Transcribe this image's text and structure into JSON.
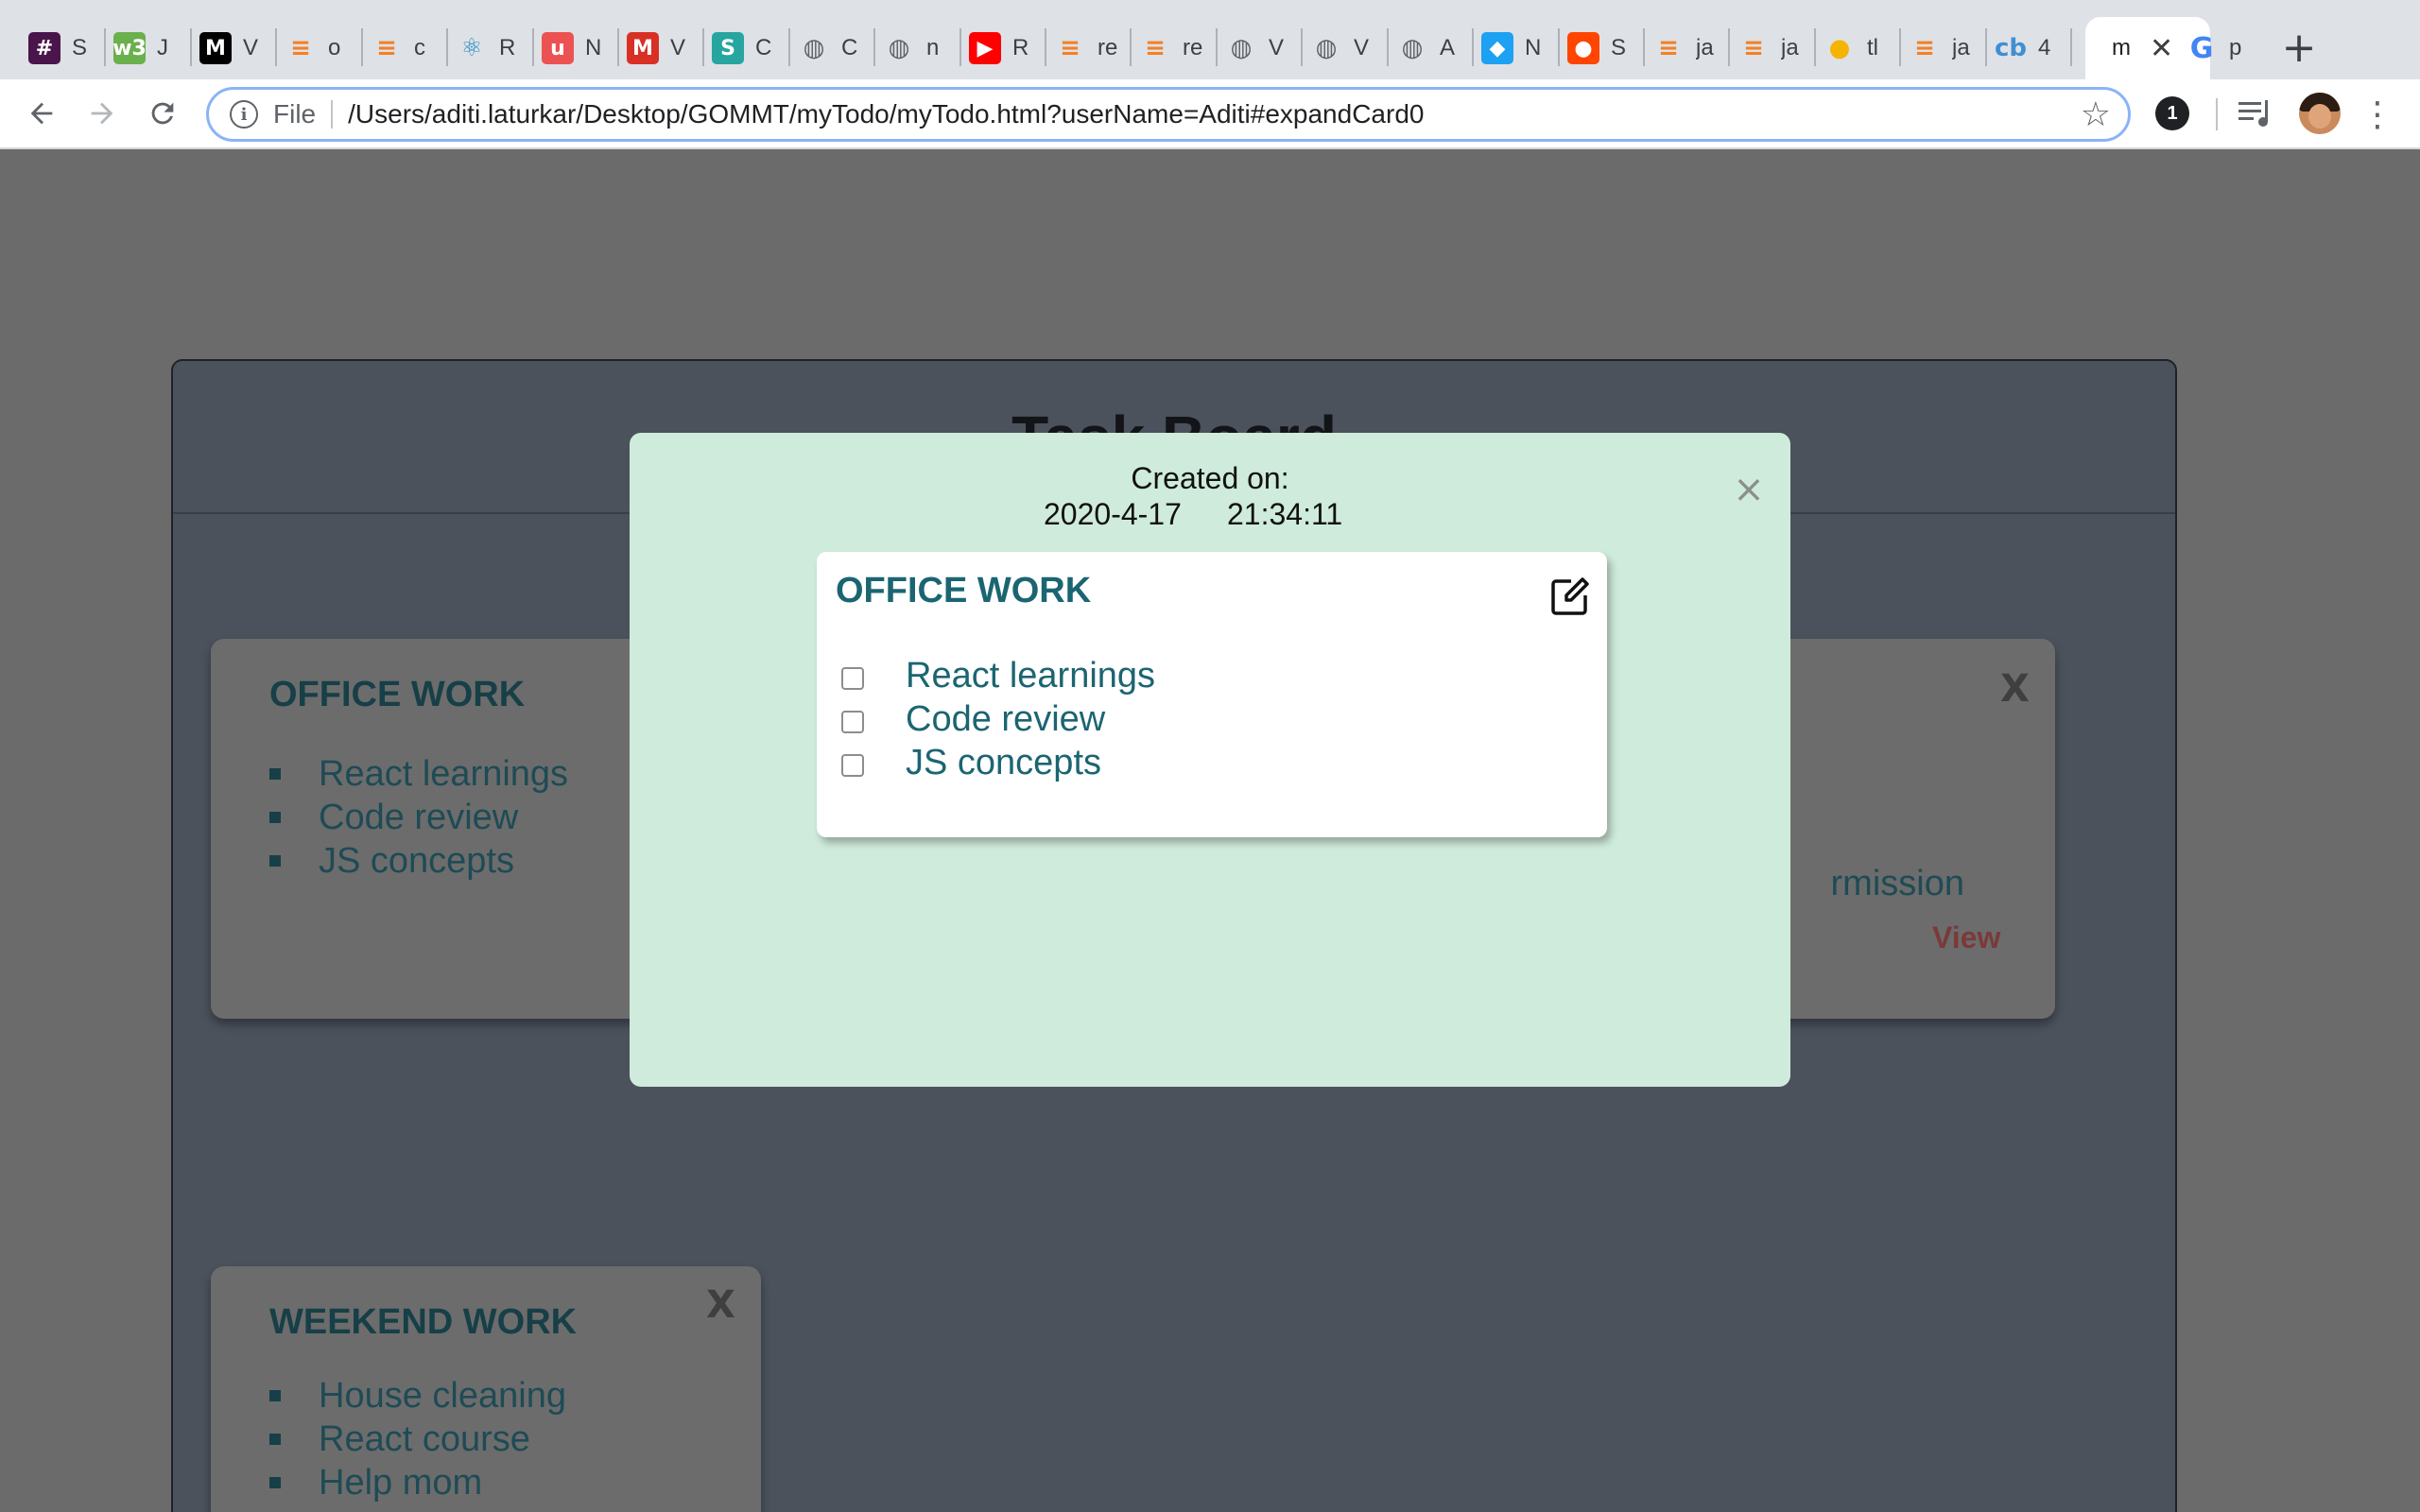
{
  "browser": {
    "tabs": [
      {
        "icon": "slack-icon",
        "label": "S",
        "color": "#4a154b"
      },
      {
        "icon": "w3schools-icon",
        "label": "J",
        "color": "#6ab04c"
      },
      {
        "icon": "medium-icon",
        "label": "V",
        "color": "#000000"
      },
      {
        "icon": "stackoverflow-icon",
        "label": "o",
        "color": "#f48024"
      },
      {
        "icon": "stackoverflow-icon",
        "label": "c",
        "color": "#f48024"
      },
      {
        "icon": "react-icon",
        "label": "R",
        "color": "#2a8fbd"
      },
      {
        "icon": "udemy-icon",
        "label": "N",
        "color": "#ec5252"
      },
      {
        "icon": "gmail-icon",
        "label": "V",
        "color": "#d93025"
      },
      {
        "icon": "s-app-icon",
        "label": "C",
        "color": "#27a5a0"
      },
      {
        "icon": "globe-icon",
        "label": "C",
        "color": "#5f6368"
      },
      {
        "icon": "globe-icon",
        "label": "n",
        "color": "#5f6368"
      },
      {
        "icon": "youtube-icon",
        "label": "R",
        "color": "#ff0000"
      },
      {
        "icon": "stackoverflow-icon",
        "label": "re",
        "color": "#f48024"
      },
      {
        "icon": "stackoverflow-icon",
        "label": "re",
        "color": "#f48024"
      },
      {
        "icon": "globe-icon",
        "label": "V",
        "color": "#5f6368"
      },
      {
        "icon": "globe-icon",
        "label": "V",
        "color": "#5f6368"
      },
      {
        "icon": "globe-icon",
        "label": "A",
        "color": "#5f6368"
      },
      {
        "icon": "bird-icon",
        "label": "N",
        "color": "#1da1f2"
      },
      {
        "icon": "reddit-icon",
        "label": "S",
        "color": "#ff4500"
      },
      {
        "icon": "stackoverflow-icon",
        "label": "ja",
        "color": "#f48024"
      },
      {
        "icon": "stackoverflow-icon",
        "label": "ja",
        "color": "#f48024"
      },
      {
        "icon": "bulb-icon",
        "label": "tl",
        "color": "#f4b400"
      },
      {
        "icon": "stackoverflow-icon",
        "label": "ja",
        "color": "#f48024"
      },
      {
        "icon": "codebeautify-icon",
        "label": "4",
        "color": "#3f8fd2"
      }
    ],
    "active_tab": {
      "label": "m",
      "close": "✕"
    },
    "last_tab": {
      "icon": "google-icon",
      "label": "p"
    },
    "new_tab": "+",
    "omnibox": {
      "scheme_label": "File",
      "url": "/Users/aditi.laturkar/Desktop/GOMMT/myTodo/myTodo.html?userName=Aditi#expandCard0"
    },
    "extension_badge": "1"
  },
  "board": {
    "title": "Task Board",
    "cards": [
      {
        "title": "OFFICE WORK",
        "items": [
          "React learnings",
          "Code review",
          "JS concepts"
        ]
      },
      {
        "close": "X",
        "partial_item": "rmission",
        "view": "View"
      },
      {
        "title": "WEEKEND WORK",
        "close": "X",
        "items": [
          "House cleaning",
          "React course",
          "Help mom"
        ]
      }
    ]
  },
  "modal": {
    "created_label": "Created on:",
    "date": "2020-4-17",
    "time": "21:34:11",
    "close": "×",
    "note": {
      "title": "OFFICE WORK",
      "items": [
        {
          "label": "React learnings",
          "checked": false
        },
        {
          "label": "Code review",
          "checked": false
        },
        {
          "label": "JS concepts",
          "checked": false
        }
      ]
    }
  },
  "colors": {
    "modal_bg": "#cfebdb",
    "note_text": "#1b6572",
    "overlay": "#6b6b6b",
    "board_bg": "#4b525c"
  }
}
